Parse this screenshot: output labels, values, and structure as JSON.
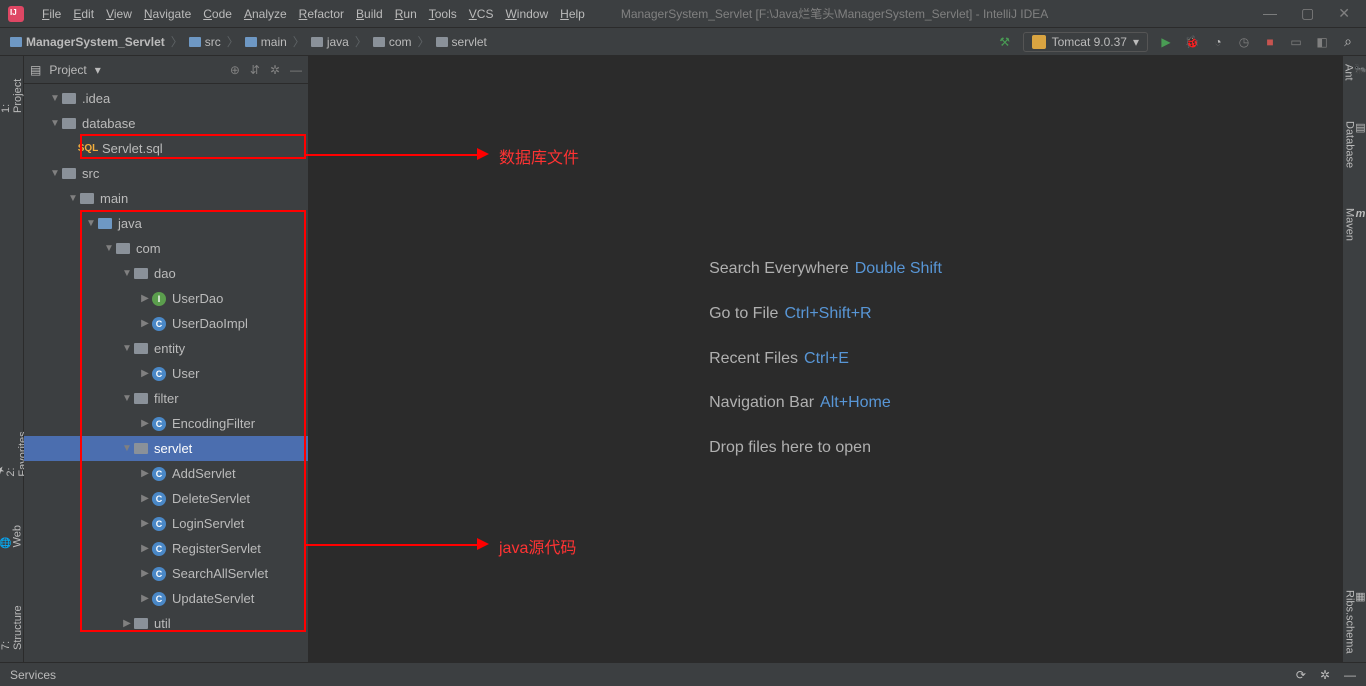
{
  "menubar": {
    "items": [
      "File",
      "Edit",
      "View",
      "Navigate",
      "Code",
      "Analyze",
      "Refactor",
      "Build",
      "Run",
      "Tools",
      "VCS",
      "Window",
      "Help"
    ],
    "title": "ManagerSystem_Servlet [F:\\Java烂笔头\\ManagerSystem_Servlet] - IntelliJ IDEA"
  },
  "breadcrumb": [
    "ManagerSystem_Servlet",
    "src",
    "main",
    "java",
    "com",
    "servlet"
  ],
  "runconfig": {
    "label": "Tomcat 9.0.37"
  },
  "project_panel": {
    "title": "Project"
  },
  "tree": [
    {
      "indent": 1,
      "arrow": "open",
      "icon": "folder",
      "label": ".idea"
    },
    {
      "indent": 1,
      "arrow": "open",
      "icon": "folder",
      "label": "database"
    },
    {
      "indent": 2,
      "arrow": "none",
      "icon": "sql",
      "label": "Servlet.sql"
    },
    {
      "indent": 1,
      "arrow": "open",
      "icon": "folder",
      "label": "src"
    },
    {
      "indent": 2,
      "arrow": "open",
      "icon": "folder",
      "label": "main"
    },
    {
      "indent": 3,
      "arrow": "open",
      "icon": "bfolder",
      "label": "java"
    },
    {
      "indent": 4,
      "arrow": "open",
      "icon": "pkg",
      "label": "com"
    },
    {
      "indent": 5,
      "arrow": "open",
      "icon": "pkg",
      "label": "dao"
    },
    {
      "indent": 6,
      "arrow": "closed",
      "icon": "iface",
      "label": "UserDao"
    },
    {
      "indent": 6,
      "arrow": "closed",
      "icon": "cls",
      "label": "UserDaoImpl"
    },
    {
      "indent": 5,
      "arrow": "open",
      "icon": "pkg",
      "label": "entity"
    },
    {
      "indent": 6,
      "arrow": "closed",
      "icon": "cls",
      "label": "User"
    },
    {
      "indent": 5,
      "arrow": "open",
      "icon": "pkg",
      "label": "filter"
    },
    {
      "indent": 6,
      "arrow": "closed",
      "icon": "cls",
      "label": "EncodingFilter"
    },
    {
      "indent": 5,
      "arrow": "open",
      "icon": "pkg",
      "label": "servlet",
      "selected": true
    },
    {
      "indent": 6,
      "arrow": "closed",
      "icon": "cls",
      "label": "AddServlet"
    },
    {
      "indent": 6,
      "arrow": "closed",
      "icon": "cls",
      "label": "DeleteServlet"
    },
    {
      "indent": 6,
      "arrow": "closed",
      "icon": "cls",
      "label": "LoginServlet"
    },
    {
      "indent": 6,
      "arrow": "closed",
      "icon": "cls",
      "label": "RegisterServlet"
    },
    {
      "indent": 6,
      "arrow": "closed",
      "icon": "cls",
      "label": "SearchAllServlet"
    },
    {
      "indent": 6,
      "arrow": "closed",
      "icon": "cls",
      "label": "UpdateServlet"
    },
    {
      "indent": 5,
      "arrow": "closed",
      "icon": "pkg",
      "label": "util"
    }
  ],
  "welcome": [
    {
      "text": "Search Everywhere",
      "key": "Double Shift"
    },
    {
      "text": "Go to File",
      "key": "Ctrl+Shift+R"
    },
    {
      "text": "Recent Files",
      "key": "Ctrl+E"
    },
    {
      "text": "Navigation Bar",
      "key": "Alt+Home"
    },
    {
      "text": "Drop files here to open",
      "key": ""
    }
  ],
  "left_tabs": {
    "project": "1: Project",
    "favorites": "2: Favorites",
    "web": "Web",
    "structure": "7: Structure"
  },
  "right_tabs": {
    "ant": "Ant",
    "database": "Database",
    "maven": "Maven",
    "ribs": "Ribs.schema"
  },
  "statusbar": {
    "services": "Services"
  },
  "annotations": {
    "db": "数据库文件",
    "java": "java源代码"
  }
}
